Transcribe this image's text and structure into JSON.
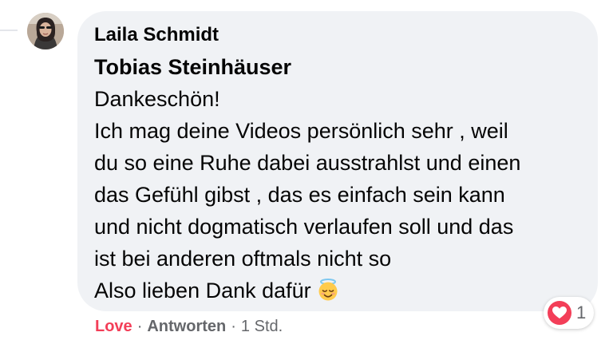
{
  "comment": {
    "author": "Laila Schmidt",
    "mention": "Tobias Steinhäuser",
    "lines": [
      "Dankeschön!",
      "Ich mag deine Videos persönlich sehr , weil",
      "du so eine Ruhe dabei ausstrahlst und einen",
      "das Gefühl gibst , das es einfach sein kann",
      "und nicht dogmatisch verlaufen soll und das",
      "ist bei anderen oftmals nicht so",
      "Also lieben Dank dafür"
    ],
    "emoji": "smiling-face-with-halo-emoji"
  },
  "reactions": {
    "icon": "heart-icon",
    "count": "1"
  },
  "actions": {
    "love_label": "Love",
    "separator": "·",
    "reply_label": "Antworten",
    "timestamp": "1 Std."
  },
  "colors": {
    "bubble": "#f0f2f5",
    "love": "#f33e58",
    "meta_text": "#65676b",
    "text": "#050505"
  }
}
